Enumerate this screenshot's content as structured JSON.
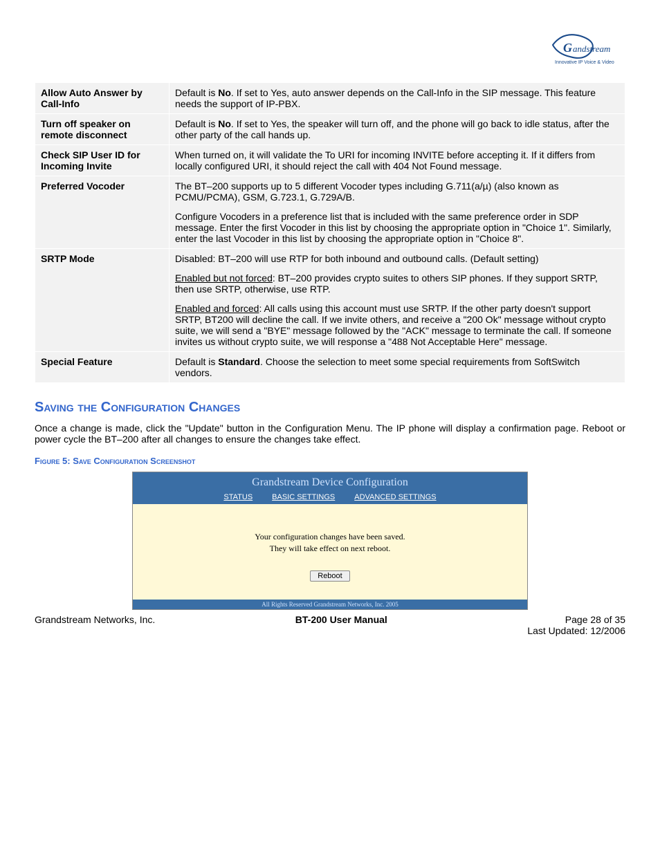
{
  "logo_tagline": "Innovative IP Voice & Video",
  "table": {
    "rows": [
      {
        "label": "Allow Auto Answer by Call-Info",
        "desc_html": "Default is <span class='bold'>No</span>. If set to Yes, auto answer depends on the Call-Info in the SIP message. This feature needs the support of IP-PBX."
      },
      {
        "label": "Turn off speaker on remote disconnect",
        "desc_html": "Default is <span class='bold'>No</span>. If set to Yes, the speaker will turn off, and the phone will go back to idle status, after the other party of the call hands up."
      },
      {
        "label": "Check SIP User ID for Incoming Invite",
        "desc_html": "When turned on, it will validate the To URI for incoming INVITE before accepting it.  If it differs from locally configured URI, it should reject the call with 404 Not Found message."
      },
      {
        "label": "Preferred Vocoder",
        "desc_html": "<p class='para'>The BT–200 supports up to 5 different Vocoder types including G.711(a/µ) (also known as PCMU/PCMA), GSM, G.723.1, G.729A/B.</p><p class='para'>Configure Vocoders in a preference list that is included with the same preference order in SDP message. Enter the first Vocoder in this list by choosing the appropriate option in \"Choice 1\". Similarly, enter the last Vocoder in this list by choosing the appropriate option in \"Choice 8\".</p>"
      },
      {
        "label": "SRTP Mode",
        "desc_html": "<p class='para'>Disabled: BT–200 will use RTP for both inbound and outbound calls. (Default setting)</p><p class='para'><span class='underline'>Enabled but not forced</span>: BT–200 provides crypto suites to others SIP phones. If they support SRTP, then use SRTP, otherwise, use RTP.</p><p class='para'><span class='underline'>Enabled and forced</span>: All calls using this account must use SRTP. If the other party doesn't support SRTP, BT200 will decline the call. If we invite others, and receive a \"200 Ok\" message without crypto suite, we will send a \"BYE\" message followed by the \"ACK\" message to terminate the call. If someone invites us without crypto suite, we will response a \"488 Not Acceptable Here\" message.</p>"
      },
      {
        "label": "Special Feature",
        "desc_html": "Default is <span class='bold'>Standard</span>. Choose the selection to meet some special requirements from SoftSwitch vendors."
      }
    ]
  },
  "section_heading": "Saving the Configuration Changes",
  "section_body": "Once a change is made, click the \"Update\" button in the Configuration Menu. The IP phone will display a confirmation page.  Reboot or power cycle the BT–200 after all changes to ensure the changes take effect.",
  "figure_caption": "Figure 5:  Save Configuration Screenshot",
  "screenshot": {
    "title": "Grandstream Device Configuration",
    "tabs": [
      "STATUS",
      "BASIC SETTINGS",
      "ADVANCED SETTINGS"
    ],
    "msg1": "Your configuration changes have been saved.",
    "msg2": "They will take effect on next reboot.",
    "button": "Reboot",
    "footer": "All Rights Reserved Grandstream Networks, Inc. 2005"
  },
  "footer": {
    "left": "Grandstream Networks, Inc.",
    "center": "BT-200 User Manual",
    "right1": "Page 28 of 35",
    "right2": "Last Updated:  12/2006"
  }
}
